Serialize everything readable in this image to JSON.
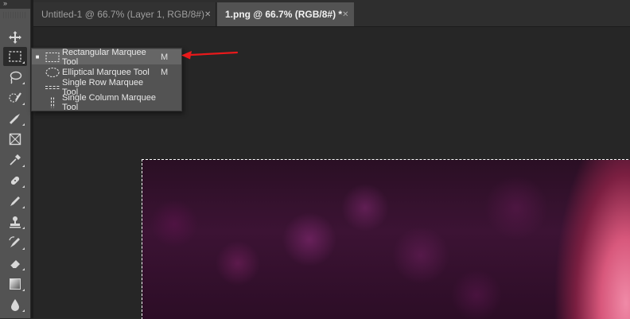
{
  "window": {
    "collapse_glyph": "»"
  },
  "tabs": [
    {
      "label": "Untitled-1 @ 66.7% (Layer 1, RGB/8#)",
      "close": "✕",
      "active": false
    },
    {
      "label": "1.png @ 66.7% (RGB/8#) *",
      "close": "✕",
      "active": true
    }
  ],
  "toolbar": {
    "tools": [
      {
        "name": "move-tool",
        "icon": "move-icon"
      },
      {
        "name": "rectangular-marquee-tool",
        "icon": "rectangular-marquee-icon",
        "active": true
      },
      {
        "name": "lasso-tool",
        "icon": "lasso-icon"
      },
      {
        "name": "quick-selection-tool",
        "icon": "quick-selection-icon"
      },
      {
        "name": "crop-tool",
        "icon": "crop-icon"
      },
      {
        "name": "frame-tool",
        "icon": "frame-icon"
      },
      {
        "name": "eyedropper-tool",
        "icon": "eyedropper-icon"
      },
      {
        "name": "healing-brush-tool",
        "icon": "healing-brush-icon"
      },
      {
        "name": "brush-tool",
        "icon": "brush-icon"
      },
      {
        "name": "clone-stamp-tool",
        "icon": "clone-stamp-icon"
      },
      {
        "name": "history-brush-tool",
        "icon": "history-brush-icon"
      },
      {
        "name": "eraser-tool",
        "icon": "eraser-icon"
      },
      {
        "name": "gradient-tool",
        "icon": "gradient-icon"
      },
      {
        "name": "blur-tool",
        "icon": "blur-drop-icon"
      }
    ]
  },
  "flyout": {
    "items": [
      {
        "label": "Rectangular Marquee Tool",
        "shortcut": "M",
        "selected": true,
        "icon": "rectangular-marquee-icon"
      },
      {
        "label": "Elliptical Marquee Tool",
        "shortcut": "M",
        "selected": false,
        "icon": "elliptical-marquee-icon"
      },
      {
        "label": "Single Row Marquee Tool",
        "shortcut": "",
        "selected": false,
        "icon": "single-row-marquee-icon"
      },
      {
        "label": "Single Column Marquee Tool",
        "shortcut": "",
        "selected": false,
        "icon": "single-column-marquee-icon"
      }
    ],
    "selected_bullet": "■"
  },
  "colors": {
    "annotation_arrow": "#e8191b",
    "toolbar_bg": "#535353",
    "canvas_bg": "#282828"
  }
}
